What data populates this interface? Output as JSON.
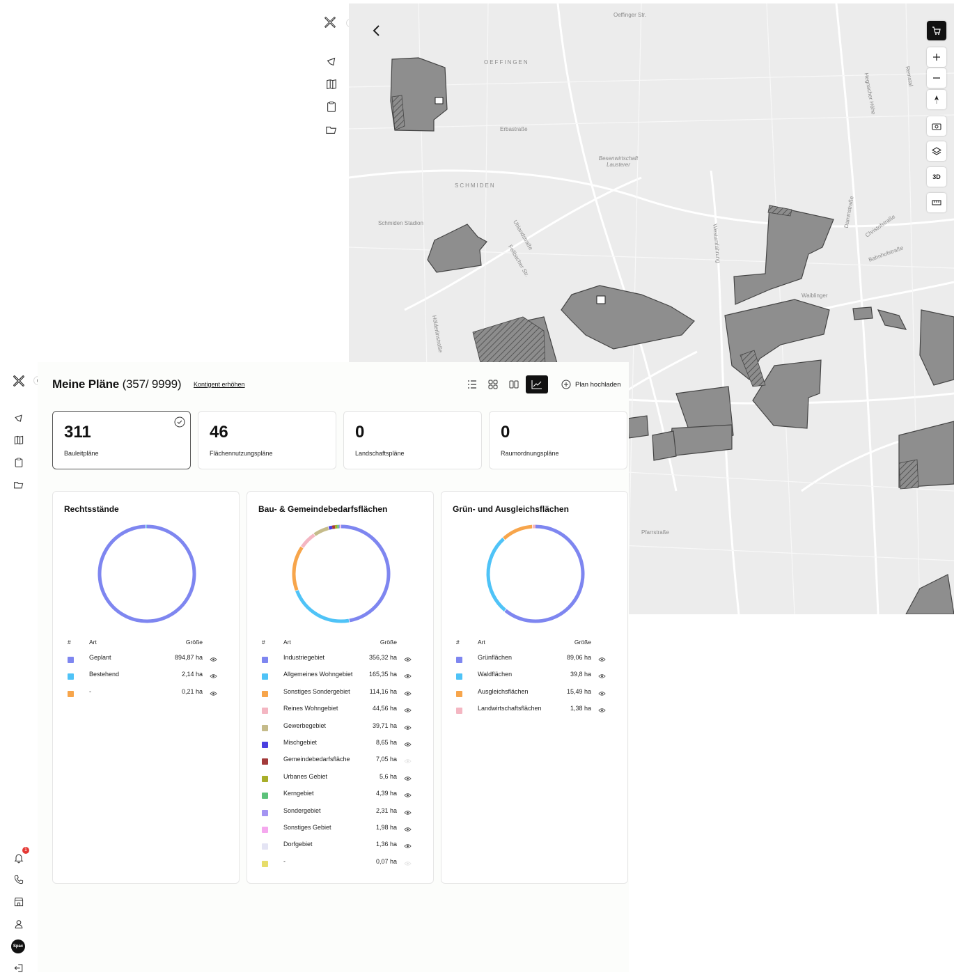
{
  "map": {
    "place_labels": [
      "Oeffinger Str.",
      "OEFFINGEN",
      "Erbastraße",
      "Besenwirtschaft Lausterer",
      "SCHMIDEN",
      "Schmiden Stadion",
      "Hölderlinstraße",
      "Uhlandstraße",
      "Fellbacher Str.",
      "Waiblinger",
      "Westumfahrung",
      "Dammstraße",
      "Bahnhofstraße",
      "Christofstraße",
      "Pfarrstraße",
      "Hegnacher Höhe",
      "Remstal"
    ],
    "tools": {
      "three_d": "3D"
    }
  },
  "header": {
    "title": "Meine Pläne",
    "count": "(357/ 9999)",
    "quota_link": "Kontigent erhöhen",
    "upload_label": "Plan hochladen"
  },
  "stats": [
    {
      "value": "311",
      "label": "Bauleitpläne",
      "selected": true
    },
    {
      "value": "46",
      "label": "Flächennutzungspläne",
      "selected": false
    },
    {
      "value": "0",
      "label": "Landschaftspläne",
      "selected": false
    },
    {
      "value": "0",
      "label": "Raumordnungspläne",
      "selected": false
    }
  ],
  "legend_headers": {
    "hash": "#",
    "art": "Art",
    "size": "Größe"
  },
  "charts": [
    {
      "title": "Rechtsstände",
      "rows": [
        {
          "art": "Geplant",
          "size": "894,87 ha",
          "value": 894.87,
          "color": "#7e86f0",
          "visible": true
        },
        {
          "art": "Bestehend",
          "size": "2,14 ha",
          "value": 2.14,
          "color": "#4fc3f7",
          "visible": true
        },
        {
          "art": "-",
          "size": "0,21 ha",
          "value": 0.21,
          "color": "#f7a54b",
          "visible": true
        }
      ]
    },
    {
      "title": "Bau- & Gemeindebedarfsflächen",
      "rows": [
        {
          "art": "Industriegebiet",
          "size": "356,32 ha",
          "value": 356.32,
          "color": "#7e86f0",
          "visible": true
        },
        {
          "art": "Allgemeines Wohngebiet",
          "size": "165,35 ha",
          "value": 165.35,
          "color": "#4fc3f7",
          "visible": true
        },
        {
          "art": "Sonstiges Sondergebiet",
          "size": "114,16 ha",
          "value": 114.16,
          "color": "#f7a54b",
          "visible": true
        },
        {
          "art": "Reines Wohngebiet",
          "size": "44,56 ha",
          "value": 44.56,
          "color": "#f4b6c2",
          "visible": true
        },
        {
          "art": "Gewerbegebiet",
          "size": "39,71 ha",
          "value": 39.71,
          "color": "#c5bb8a",
          "visible": true
        },
        {
          "art": "Mischgebiet",
          "size": "8,65 ha",
          "value": 8.65,
          "color": "#4a3fe0",
          "visible": true
        },
        {
          "art": "Gemeindebedarfsfläche",
          "size": "7,05 ha",
          "value": 7.05,
          "color": "#a33a3a",
          "visible": false
        },
        {
          "art": "Urbanes Gebiet",
          "size": "5,6 ha",
          "value": 5.6,
          "color": "#a8ae2a",
          "visible": true
        },
        {
          "art": "Kerngebiet",
          "size": "4,39 ha",
          "value": 4.39,
          "color": "#5cc27a",
          "visible": true
        },
        {
          "art": "Sondergebiet",
          "size": "2,31 ha",
          "value": 2.31,
          "color": "#a494f2",
          "visible": true
        },
        {
          "art": "Sonstiges Gebiet",
          "size": "1,98 ha",
          "value": 1.98,
          "color": "#f5a8ee",
          "visible": true
        },
        {
          "art": "Dorfgebiet",
          "size": "1,36 ha",
          "value": 1.36,
          "color": "#e4e4f4",
          "visible": true
        },
        {
          "art": "-",
          "size": "0,07 ha",
          "value": 0.07,
          "color": "#e7dd6a",
          "visible": false
        }
      ]
    },
    {
      "title": "Grün- und Ausgleichsflächen",
      "rows": [
        {
          "art": "Grünflächen",
          "size": "89,06 ha",
          "value": 89.06,
          "color": "#7e86f0",
          "visible": true
        },
        {
          "art": "Waldflächen",
          "size": "39,8 ha",
          "value": 39.8,
          "color": "#4fc3f7",
          "visible": true
        },
        {
          "art": "Ausgleichsflächen",
          "size": "15,49 ha",
          "value": 15.49,
          "color": "#f7a54b",
          "visible": true
        },
        {
          "art": "Landwirtschaftsflächen",
          "size": "1,38 ha",
          "value": 1.38,
          "color": "#f4b6c2",
          "visible": true
        }
      ]
    }
  ],
  "sidebar": {
    "user_initials": "Spac",
    "notification_count": "1"
  }
}
